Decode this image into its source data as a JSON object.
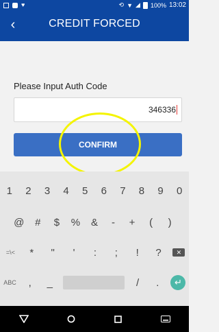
{
  "status_bar": {
    "battery": "100%",
    "time": "13:02"
  },
  "header": {
    "back_icon": "chevron-left-icon",
    "title": "CREDIT FORCED"
  },
  "form": {
    "label": "Please Input Auth Code",
    "auth_code_value": "346336",
    "confirm_label": "CONFIRM"
  },
  "keyboard": {
    "row1": [
      "1",
      "2",
      "3",
      "4",
      "5",
      "6",
      "7",
      "8",
      "9",
      "0"
    ],
    "row2": [
      "@",
      "#",
      "$",
      "%",
      "&",
      "-",
      "+",
      "(",
      ")"
    ],
    "row3_mode": "=\\<",
    "row3": [
      "*",
      "\"",
      "'",
      ":",
      ";",
      "!",
      "?"
    ],
    "row4_mode": "ABC",
    "row4": [
      ",",
      "_",
      "/",
      "."
    ]
  },
  "colors": {
    "primary": "#0d47a1",
    "button": "#3a6fc4",
    "highlight": "#f4f400",
    "enter": "#4cb8a8"
  }
}
